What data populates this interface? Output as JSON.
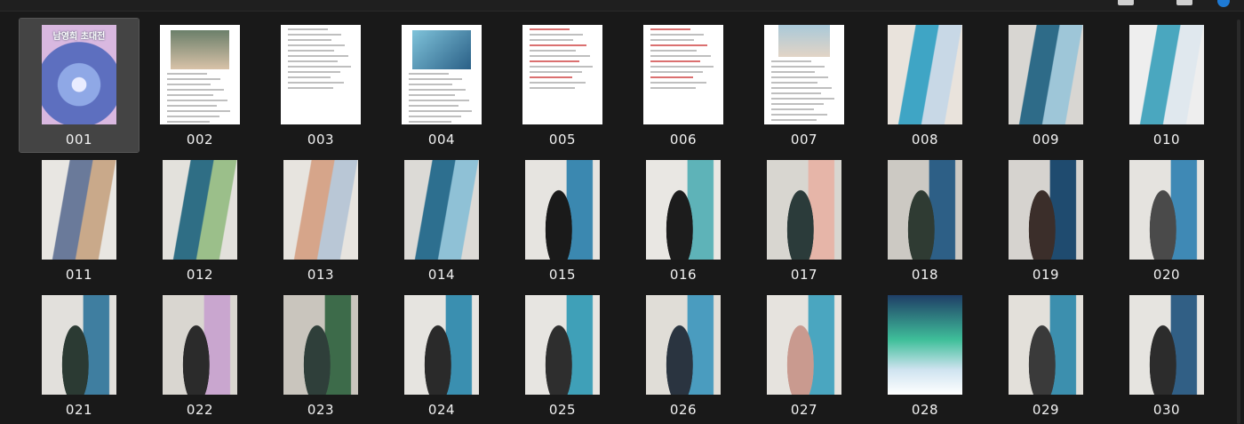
{
  "toolbar": {
    "icons": [
      "window-icon",
      "window-icon",
      "notification-dot-icon"
    ]
  },
  "poster": {
    "title": "남영희 초대전"
  },
  "items": [
    {
      "label": "001",
      "kind": "poster",
      "selected": true
    },
    {
      "label": "002",
      "kind": "doc-photo"
    },
    {
      "label": "003",
      "kind": "doc-text"
    },
    {
      "label": "004",
      "kind": "doc-image"
    },
    {
      "label": "005",
      "kind": "doc-red"
    },
    {
      "label": "006",
      "kind": "doc-red"
    },
    {
      "label": "007",
      "kind": "doc-photo-top"
    },
    {
      "label": "008",
      "kind": "gallery",
      "palette": [
        "#e9e3dc",
        "#3fa5c5",
        "#c8d8e6"
      ]
    },
    {
      "label": "009",
      "kind": "gallery",
      "palette": [
        "#d8d6d2",
        "#2e6b88",
        "#9ec6d8"
      ]
    },
    {
      "label": "010",
      "kind": "gallery",
      "palette": [
        "#eeeeee",
        "#4aa7bf",
        "#e0e8ee"
      ]
    },
    {
      "label": "011",
      "kind": "gallery",
      "palette": [
        "#e8e6e2",
        "#6a7a9a",
        "#c9a98a"
      ]
    },
    {
      "label": "012",
      "kind": "gallery",
      "palette": [
        "#e3e1dc",
        "#2f6e85",
        "#9bbf8a"
      ]
    },
    {
      "label": "013",
      "kind": "gallery",
      "palette": [
        "#e7e4df",
        "#d6a58a",
        "#b9c7d6"
      ]
    },
    {
      "label": "014",
      "kind": "gallery",
      "palette": [
        "#dcdad6",
        "#2d6f8f",
        "#8fc1d6"
      ]
    },
    {
      "label": "015",
      "kind": "person",
      "palette": [
        "#e6e4e0",
        "#3b88b0",
        "#1a1a1a"
      ]
    },
    {
      "label": "016",
      "kind": "person",
      "palette": [
        "#e9e7e3",
        "#5eb3b8",
        "#1c1c1c"
      ]
    },
    {
      "label": "017",
      "kind": "person",
      "palette": [
        "#d8d6d0",
        "#e6b5a8",
        "#2b3b3a"
      ]
    },
    {
      "label": "018",
      "kind": "person",
      "palette": [
        "#ccc9c3",
        "#2d5f86",
        "#2f3b33"
      ]
    },
    {
      "label": "019",
      "kind": "person",
      "palette": [
        "#d6d3cf",
        "#1f4b6f",
        "#3b2e2a"
      ]
    },
    {
      "label": "020",
      "kind": "person",
      "palette": [
        "#e5e3df",
        "#3f89b5",
        "#4a4a4a"
      ]
    },
    {
      "label": "021",
      "kind": "person",
      "palette": [
        "#e2e0dc",
        "#3f7ea0",
        "#2b3a33"
      ]
    },
    {
      "label": "022",
      "kind": "person",
      "palette": [
        "#d9d6d0",
        "#c9a6cf",
        "#2b2b2b"
      ]
    },
    {
      "label": "023",
      "kind": "person",
      "palette": [
        "#c9c5bd",
        "#3d6b4a",
        "#2f3f3a"
      ]
    },
    {
      "label": "024",
      "kind": "person",
      "palette": [
        "#e6e4e0",
        "#3a8fb0",
        "#2a2a2a"
      ]
    },
    {
      "label": "025",
      "kind": "person",
      "palette": [
        "#e7e5e1",
        "#3fa0b8",
        "#2e2e2e"
      ]
    },
    {
      "label": "026",
      "kind": "person",
      "palette": [
        "#e0ddd7",
        "#4a9cbf",
        "#2a3440"
      ]
    },
    {
      "label": "027",
      "kind": "person",
      "palette": [
        "#e6e3de",
        "#4aa6c0",
        "#c99a8f"
      ]
    },
    {
      "label": "028",
      "kind": "aurora",
      "palette": [
        "#1f3e66",
        "#3fbf9a",
        "#cfe3f0"
      ]
    },
    {
      "label": "029",
      "kind": "person",
      "palette": [
        "#e3e0da",
        "#3c8fae",
        "#3a3a3a"
      ]
    },
    {
      "label": "030",
      "kind": "person",
      "palette": [
        "#e6e4e0",
        "#315f85",
        "#2c2c2c"
      ]
    }
  ]
}
